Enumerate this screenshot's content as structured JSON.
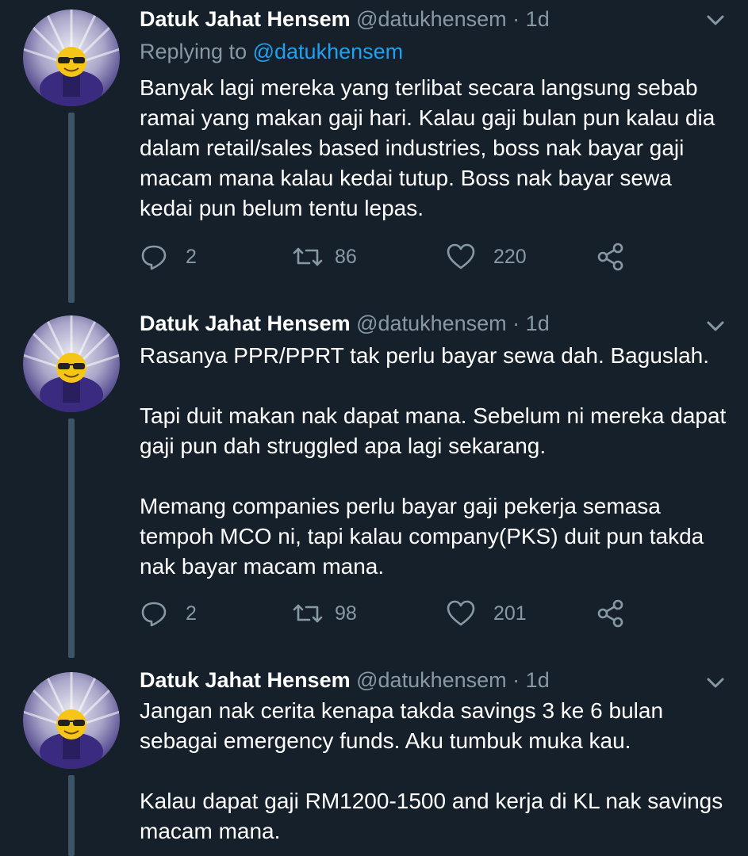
{
  "tweets": [
    {
      "name": "Datuk Jahat Hensem",
      "handle": "@datukhensem",
      "separator": "·",
      "time": "1d",
      "replying_prefix": "Replying to",
      "replying_to": "@datukhensem",
      "paragraphs": [
        "Banyak lagi mereka yang terlibat secara langsung sebab ramai yang makan gaji hari. Kalau gaji bulan pun kalau dia dalam retail/sales based industries, boss nak bayar gaji macam mana kalau kedai tutup. Boss nak bayar sewa kedai pun belum tentu lepas."
      ],
      "replies": "2",
      "retweets": "86",
      "likes": "220"
    },
    {
      "name": "Datuk Jahat Hensem",
      "handle": "@datukhensem",
      "separator": "·",
      "time": "1d",
      "paragraphs": [
        "Rasanya PPR/PPRT tak perlu bayar sewa dah. Baguslah.",
        "Tapi duit makan nak dapat mana. Sebelum ni mereka dapat gaji pun dah struggled apa lagi sekarang.",
        "Memang companies perlu bayar gaji pekerja semasa tempoh MCO ni, tapi kalau company(PKS) duit pun takda nak bayar macam mana."
      ],
      "replies": "2",
      "retweets": "98",
      "likes": "201"
    },
    {
      "name": "Datuk Jahat Hensem",
      "handle": "@datukhensem",
      "separator": "·",
      "time": "1d",
      "paragraphs": [
        "Jangan nak cerita kenapa takda savings 3 ke 6 bulan sebagai emergency funds. Aku tumbuk muka kau.",
        "Kalau dapat gaji RM1200-1500 and kerja di KL nak savings macam mana."
      ]
    }
  ],
  "icons": {
    "reply": "reply-icon",
    "retweet": "retweet-icon",
    "like": "heart-icon",
    "share": "share-icon",
    "caret": "chevron-down-icon",
    "avatar_emoji": "😎"
  },
  "colors": {
    "background": "#15202b",
    "text": "#ffffff",
    "secondary": "#8899a6",
    "link": "#1da1f2",
    "thread_line": "#3d5466"
  }
}
